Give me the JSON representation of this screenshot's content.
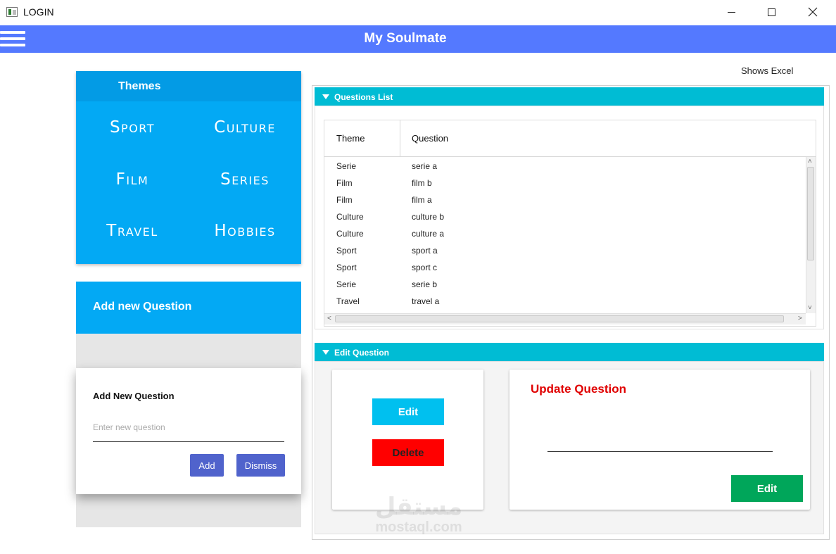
{
  "window": {
    "title": "LOGIN"
  },
  "app": {
    "title": "My Soulmate"
  },
  "themes": {
    "title": "Themes",
    "items": [
      "Sport",
      "Culture",
      "Film",
      "Series",
      "Travel",
      "Hobbies"
    ]
  },
  "add_question": {
    "header": "Add new Question",
    "dialog_title": "Add New Question",
    "input_placeholder": "Enter new question",
    "input_value": "",
    "add_label": "Add",
    "dismiss_label": "Dismiss"
  },
  "shows_excel": "Shows Excel",
  "questions_list": {
    "title": "Questions List",
    "columns": [
      "Theme",
      "Question"
    ],
    "rows": [
      [
        "Serie",
        "serie a"
      ],
      [
        "Film",
        "film b"
      ],
      [
        "Film",
        "film a"
      ],
      [
        "Culture",
        "culture b"
      ],
      [
        "Culture",
        "culture a"
      ],
      [
        "Sport",
        "sport a"
      ],
      [
        "Sport",
        "sport c"
      ],
      [
        "Serie",
        "serie b"
      ],
      [
        "Travel",
        "travel a"
      ]
    ]
  },
  "edit_question": {
    "title": "Edit Question",
    "edit_label": "Edit",
    "delete_label": "Delete",
    "update_title": "Update Question",
    "update_value": "",
    "update_edit_label": "Edit"
  },
  "watermark": {
    "arabic": "مستقل",
    "latin": "mostaql.com"
  },
  "colors": {
    "app_bar": "#5479ff",
    "themes_bg": "#03a9f4",
    "section_header": "#00bcd4",
    "edit_button": "#00c0ef",
    "delete_button": "#ff0000",
    "update_edit_button": "#00a65a",
    "dialog_button": "#5063cc",
    "update_title": "#e00000"
  }
}
